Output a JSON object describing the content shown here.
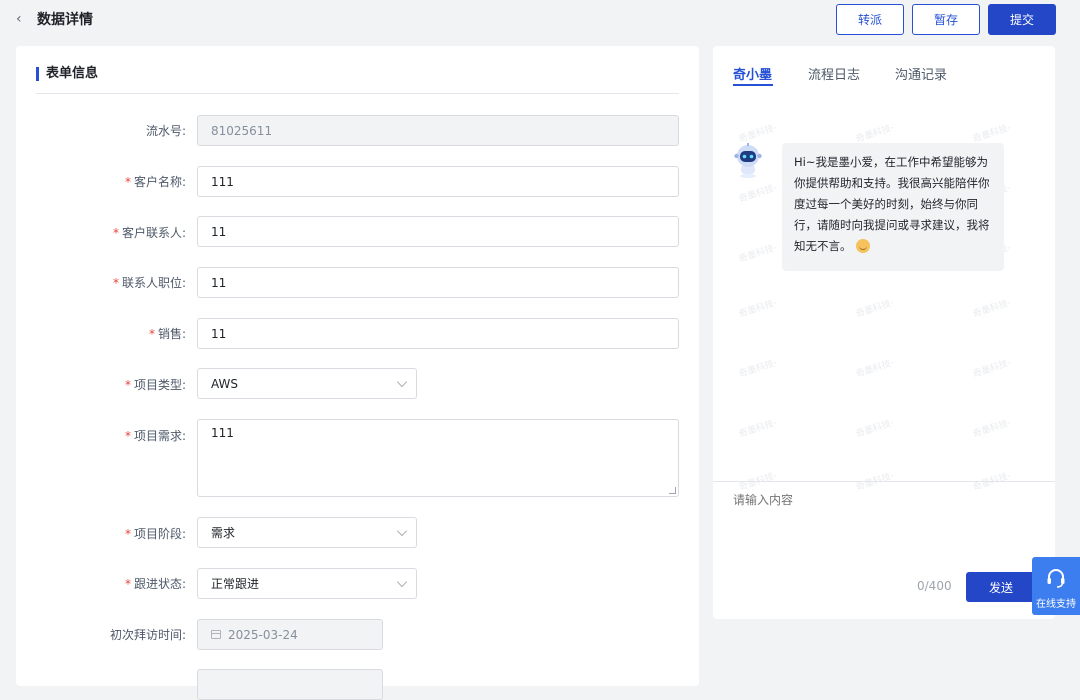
{
  "header": {
    "back_icon": "chevron-left-icon",
    "title": "数据详情",
    "buttons": {
      "transfer": "转派",
      "save_draft": "暂存",
      "submit": "提交"
    }
  },
  "form": {
    "section_title": "表单信息",
    "fields": {
      "serial_no": {
        "label": "流水号:",
        "value": "81025611"
      },
      "customer_name": {
        "label": "客户名称:",
        "value": "111"
      },
      "customer_contact": {
        "label": "客户联系人:",
        "value": "11"
      },
      "contact_position": {
        "label": "联系人职位:",
        "value": "11"
      },
      "sales": {
        "label": "销售:",
        "value": "11"
      },
      "project_type": {
        "label": "项目类型:",
        "value": "AWS"
      },
      "project_requirement": {
        "label": "项目需求:",
        "value": "111"
      },
      "project_stage": {
        "label": "项目阶段:",
        "value": "需求"
      },
      "follow_status": {
        "label": "跟进状态:",
        "value": "正常跟进"
      },
      "first_visit": {
        "label": "初次拜访时间:",
        "value": "2025-03-24"
      }
    },
    "required_mark": "*"
  },
  "chat": {
    "tabs": [
      "奇小墨",
      "流程日志",
      "沟通记录"
    ],
    "watermark": "奇墨科技-",
    "bot_message": "Hi~我是墨小爱，在工作中希望能够为你提供帮助和支持。我很高兴能陪伴你度过每一个美好的时刻，始终与你同行，请随时向我提问或寻求建议，我将知无不言。",
    "input_placeholder": "请输入内容",
    "char_count": "0/400",
    "send_label": "发送"
  },
  "support": {
    "label": "在线支持",
    "icon": "headset-icon"
  },
  "colors": {
    "primary": "#2447c8",
    "accent": "#2651d6",
    "required": "#e8453c",
    "support": "#3c7ef0"
  }
}
